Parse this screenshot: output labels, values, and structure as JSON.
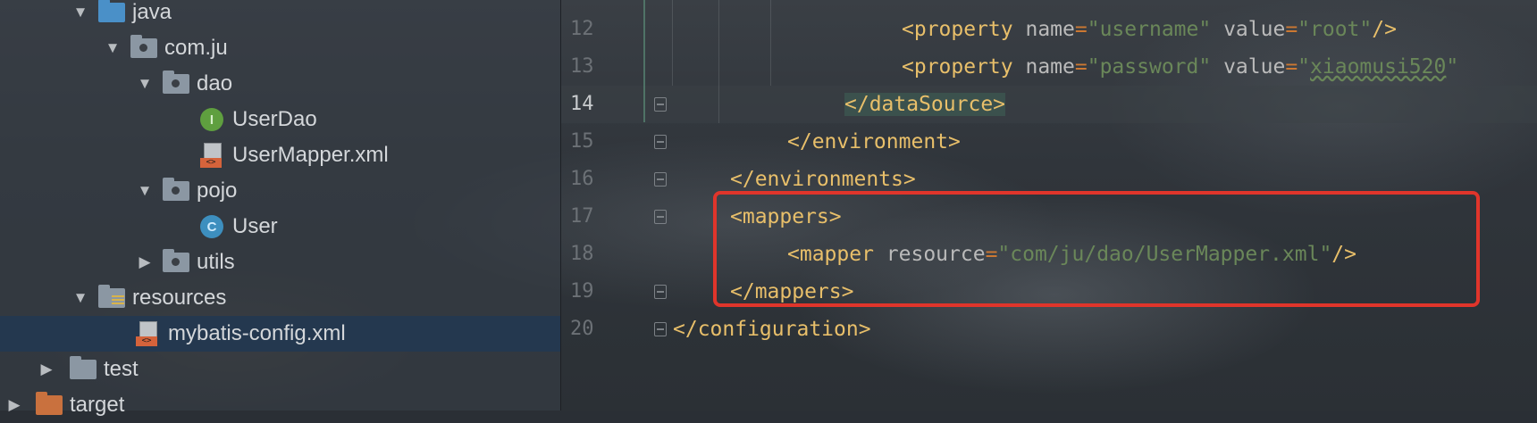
{
  "project_tree": {
    "items": [
      {
        "label": "java",
        "icon": "folder-blue-icon",
        "expanded": true
      },
      {
        "label": "com.ju",
        "icon": "package-icon",
        "expanded": true
      },
      {
        "label": "dao",
        "icon": "package-icon",
        "expanded": true
      },
      {
        "label": "UserDao",
        "icon": "interface-icon",
        "badge": "I"
      },
      {
        "label": "UserMapper.xml",
        "icon": "xml-file-icon",
        "tag": "<>"
      },
      {
        "label": "pojo",
        "icon": "package-icon",
        "expanded": true
      },
      {
        "label": "User",
        "icon": "class-icon",
        "badge": "C"
      },
      {
        "label": "utils",
        "icon": "package-icon",
        "expanded": false
      },
      {
        "label": "resources",
        "icon": "resources-folder-icon",
        "expanded": true
      },
      {
        "label": "mybatis-config.xml",
        "icon": "xml-file-icon",
        "tag": "<>",
        "selected": true
      },
      {
        "label": "test",
        "icon": "folder-icon",
        "expanded": false
      },
      {
        "label": "target",
        "icon": "folder-orange-icon",
        "expanded": false
      }
    ]
  },
  "editor": {
    "line_numbers": [
      "12",
      "13",
      "14",
      "15",
      "16",
      "17",
      "18",
      "19",
      "20"
    ],
    "active_line": "14",
    "lines": [
      {
        "open": "<property",
        "attr1": " name",
        "eq1": "=",
        "val1": "\"username\"",
        "attr2": " value",
        "eq2": "=",
        "val2": "\"root\"",
        "close": "/>"
      },
      {
        "open": "<property",
        "attr1": " name",
        "eq1": "=",
        "val1": "\"password\"",
        "attr2": " value",
        "eq2": "=",
        "val2_q": "\"",
        "val2": "xiaomusi520",
        "val2_end": "\""
      },
      {
        "text": "</dataSource>"
      },
      {
        "text": "</environment>"
      },
      {
        "text": "</environments>"
      },
      {
        "text": "<mappers>"
      },
      {
        "open": "<mapper",
        "attr1": " resource",
        "eq1": "=",
        "val1": "\"com/ju/dao/UserMapper.xml\"",
        "close": "/>"
      },
      {
        "text": "</mappers>"
      },
      {
        "text": "</configuration>"
      }
    ],
    "highlight_color": "#e0352b"
  }
}
